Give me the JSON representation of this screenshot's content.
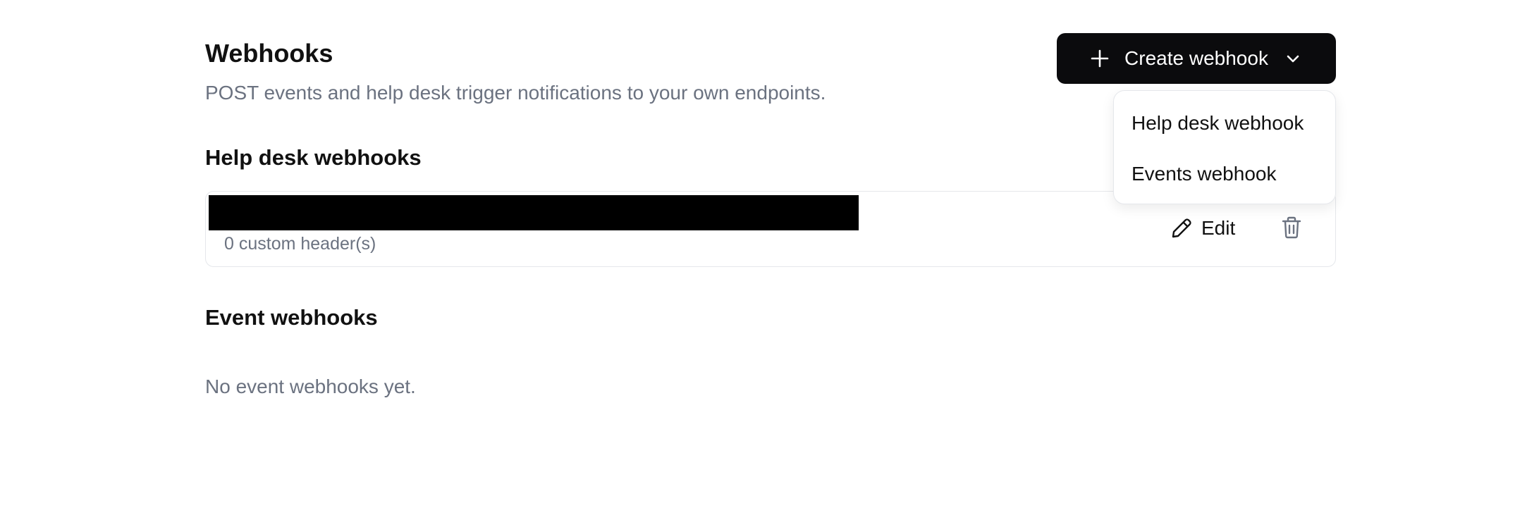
{
  "header": {
    "title": "Webhooks",
    "subtitle": "POST events and help desk trigger notifications to your own endpoints."
  },
  "create_button": {
    "label": "Create webhook",
    "icon": "plus-icon",
    "trailing_icon": "chevron-down-icon"
  },
  "create_menu": {
    "items": [
      {
        "label": "Help desk webhook"
      },
      {
        "label": "Events webhook"
      }
    ]
  },
  "help_desk": {
    "section_title": "Help desk webhooks",
    "webhooks": [
      {
        "headers_text": "0 custom header(s)",
        "edit_label": "Edit",
        "edit_icon": "pencil-icon",
        "delete_icon": "trash-icon"
      }
    ]
  },
  "events": {
    "section_title": "Event webhooks",
    "empty_text": "No event webhooks yet."
  },
  "colors": {
    "primary_button_bg": "#0b0b0d",
    "muted_text": "#6b7280",
    "border": "#e5e7eb",
    "trash_icon": "#6b7280"
  }
}
